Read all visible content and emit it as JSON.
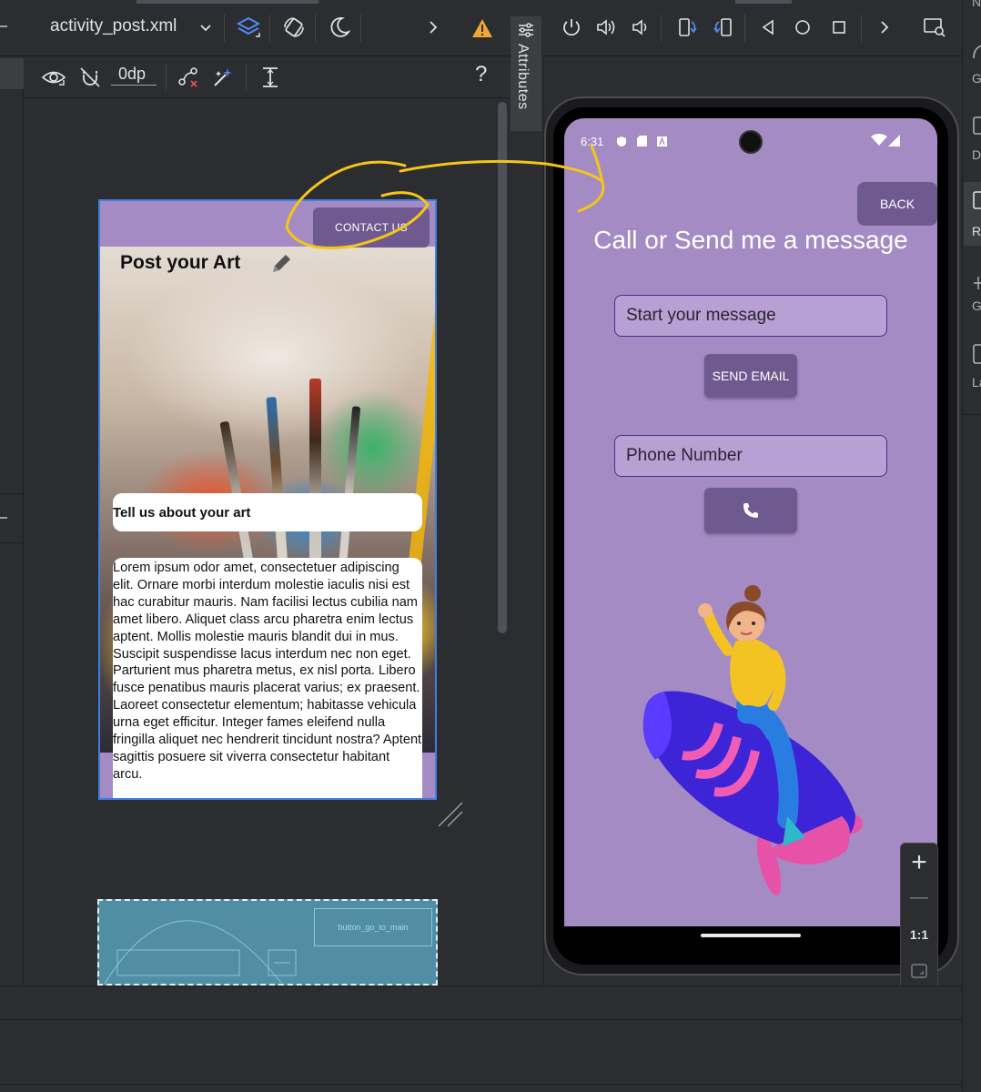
{
  "editor": {
    "file_tab": "activity_post.xml",
    "margin_value": "0dp",
    "help_label": "?",
    "attributes_tab": "Attributes"
  },
  "design_preview": {
    "contact_button": "CONTACT US",
    "title": "Post your Art",
    "tell_field": "Tell us about your art",
    "lorem_text": "Lorem ipsum odor amet, consectetuer adipiscing elit. Ornare morbi interdum molestie iaculis nisi est hac curabitur mauris. Nam facilisi lectus cubilia nam amet libero. Aliquet class arcu pharetra enim lectus aptent. Mollis molestie mauris blandit dui in mus. Suscipit suspendisse lacus interdum nec non eget. Parturient mus pharetra metus, ex nisl porta. Libero fusce penatibus mauris placerat varius; ex praesent. Laoreet consectetur elementum; habitasse vehicula urna eget efficitur. Integer fames eleifend nulla fringilla aliquet nec hendrerit tincidunt nostra? Aptent sagittis posuere sit viverra consectetur habitant arcu."
  },
  "blueprint": {
    "button_label": "button_go_to_main"
  },
  "emulator": {
    "status_time": "6:31",
    "back_button": "BACK",
    "heading": "Call or Send me a message",
    "message_placeholder": "Start your message",
    "send_button": "SEND EMAIL",
    "phone_placeholder": "Phone Number"
  },
  "zoom": {
    "plus": "+",
    "minus": "—",
    "one_to_one": "1:1"
  },
  "right_edge": {
    "labels": [
      "N",
      "G",
      "D",
      "R",
      "G",
      "La"
    ]
  },
  "colors": {
    "ide_bg": "#2b2d30",
    "accent_purple": "#a48bc4",
    "button_purple": "#6f5a8f",
    "warning": "#f0a732",
    "selection_blue": "#3d7fe3",
    "annotation_yellow": "#f5c518"
  }
}
